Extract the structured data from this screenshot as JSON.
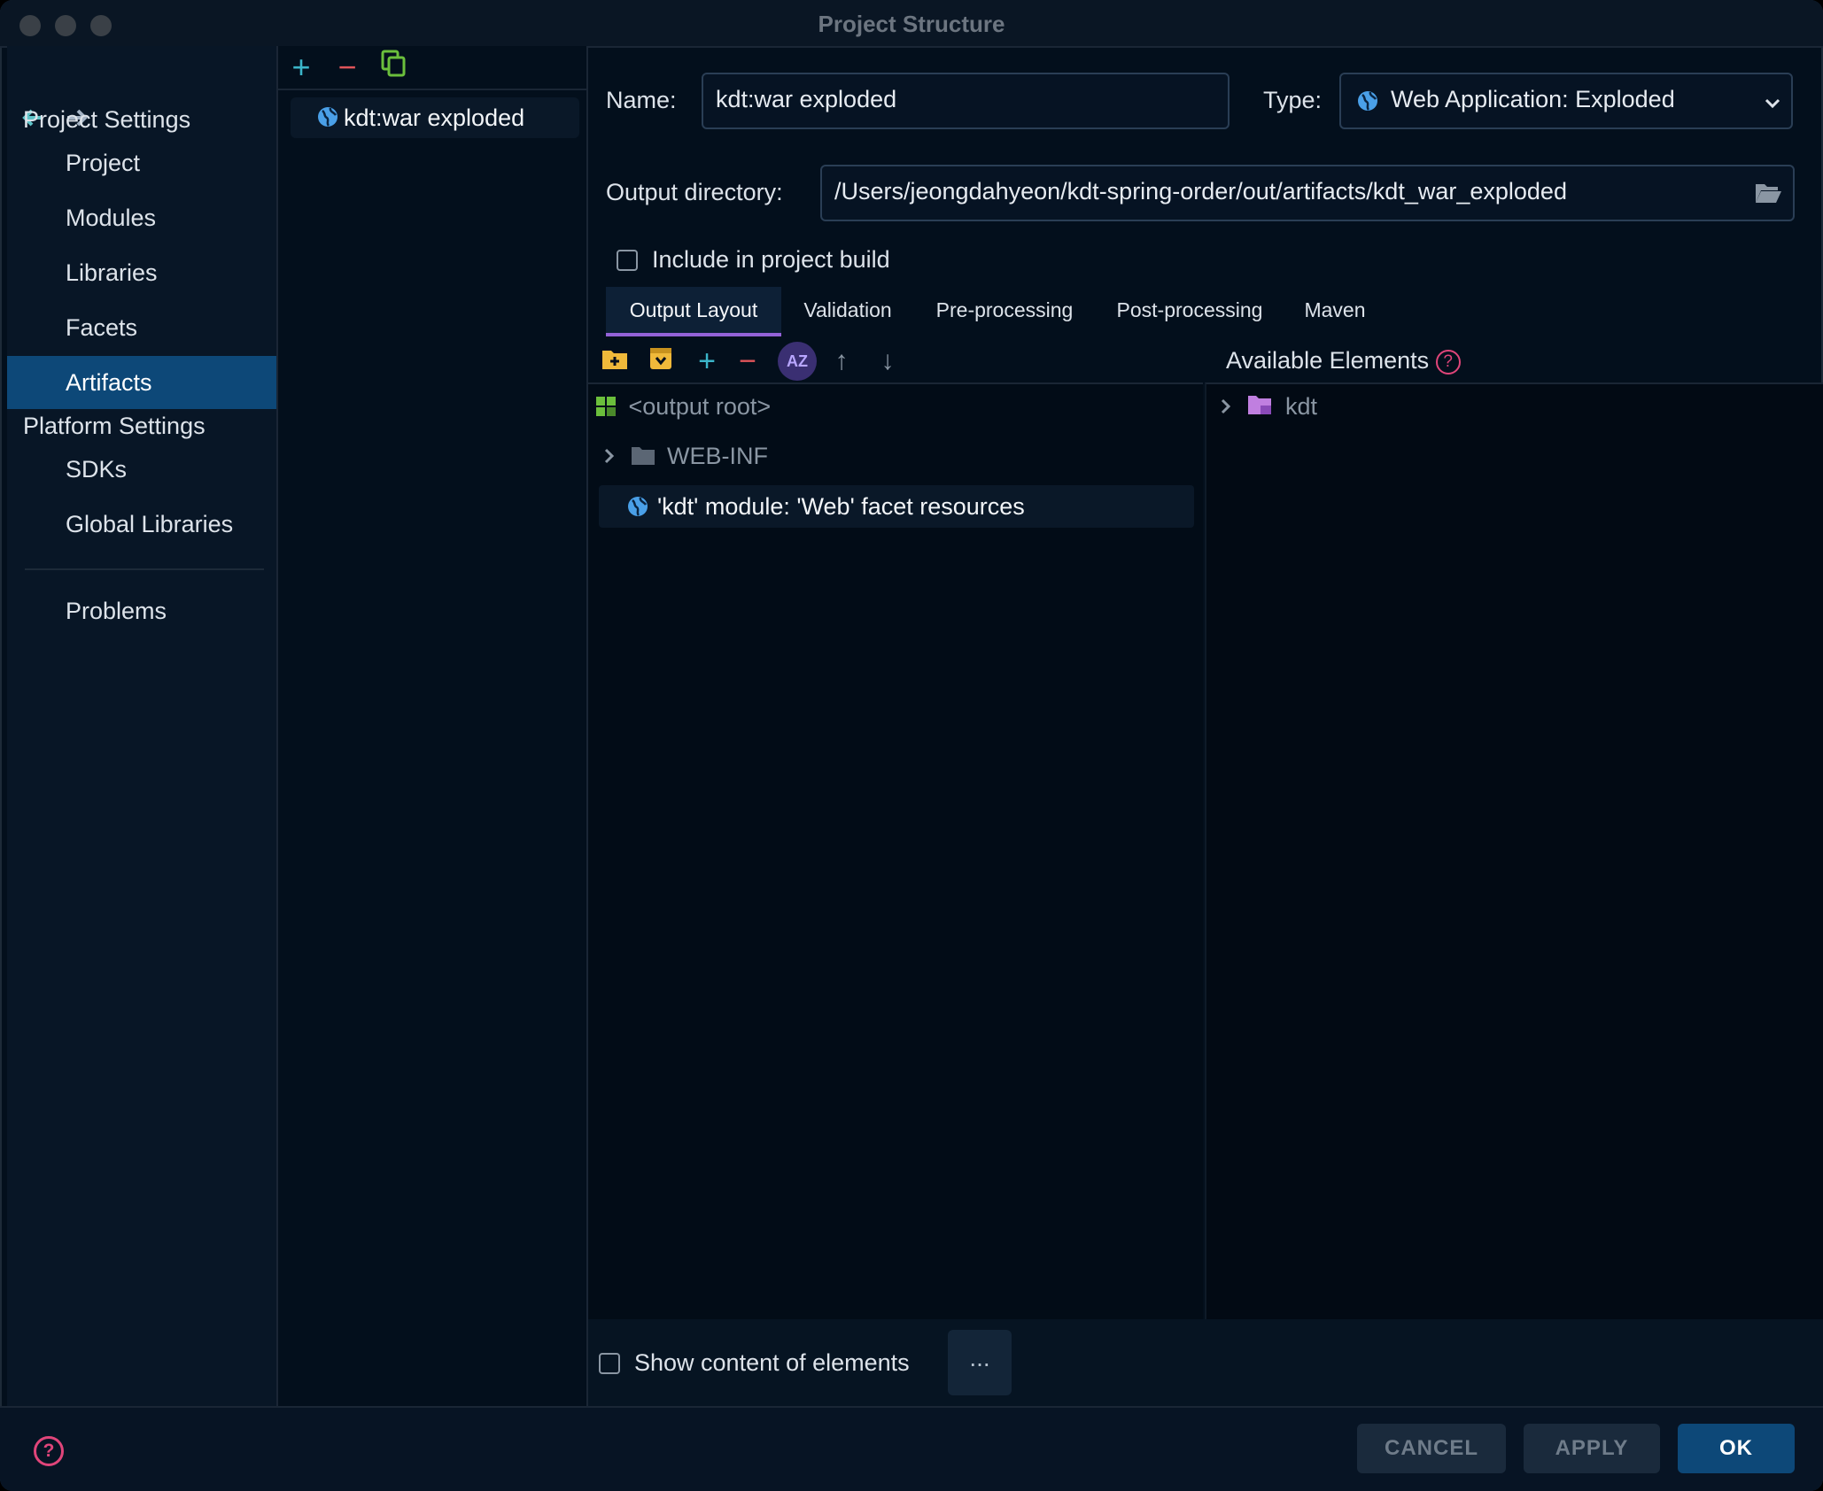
{
  "window": {
    "title": "Project Structure"
  },
  "nav": {
    "back_icon": "arrow-left-icon",
    "forward_icon": "arrow-right-icon"
  },
  "sidebar": {
    "project_settings_header": "Project Settings",
    "project_items": [
      {
        "label": "Project"
      },
      {
        "label": "Modules"
      },
      {
        "label": "Libraries"
      },
      {
        "label": "Facets"
      },
      {
        "label": "Artifacts",
        "selected": true
      }
    ],
    "platform_settings_header": "Platform Settings",
    "platform_items": [
      {
        "label": "SDKs"
      },
      {
        "label": "Global Libraries"
      }
    ],
    "problems_label": "Problems"
  },
  "artifacts": {
    "add_glyph": "+",
    "remove_glyph": "−",
    "items": [
      {
        "label": "kdt:war exploded",
        "icon": "globe-icon"
      }
    ]
  },
  "form": {
    "name_label": "Name:",
    "name_value": "kdt:war exploded",
    "type_label": "Type:",
    "type_value": "Web Application: Exploded",
    "output_dir_label": "Output directory:",
    "output_dir_value": "/Users/jeongdahyeon/kdt-spring-order/out/artifacts/kdt_war_exploded",
    "include_build_label": "Include in project build",
    "include_build_checked": false
  },
  "tabs": [
    {
      "label": "Output Layout",
      "selected": true
    },
    {
      "label": "Validation"
    },
    {
      "label": "Pre-processing"
    },
    {
      "label": "Post-processing"
    },
    {
      "label": "Maven"
    }
  ],
  "layout": {
    "add_glyph": "+",
    "remove_glyph": "−",
    "sort_glyph": "AZ",
    "up_glyph": "↑",
    "down_glyph": "↓",
    "tree": [
      {
        "label": "<output root>",
        "icon": "output-root-icon"
      },
      {
        "label": "WEB-INF",
        "icon": "folder-icon",
        "expandable": true
      },
      {
        "label": "'kdt' module: 'Web' facet resources",
        "icon": "globe-icon",
        "selected": true
      }
    ]
  },
  "available": {
    "header": "Available Elements",
    "help_glyph": "?",
    "tree": [
      {
        "label": "kdt",
        "icon": "module-folder-icon",
        "expandable": true
      }
    ]
  },
  "bottom": {
    "show_content_label": "Show content of elements",
    "show_content_checked": false,
    "more_label": "..."
  },
  "footer": {
    "help_glyph": "?",
    "cancel_label": "CANCEL",
    "apply_label": "APPLY",
    "ok_label": "OK"
  },
  "colors": {
    "accent": "#0d4878",
    "tab_underline": "#9462d8",
    "add": "#3bb5c9",
    "remove": "#e0545a",
    "help": "#e0457a",
    "ok_bg": "#0d4878"
  }
}
